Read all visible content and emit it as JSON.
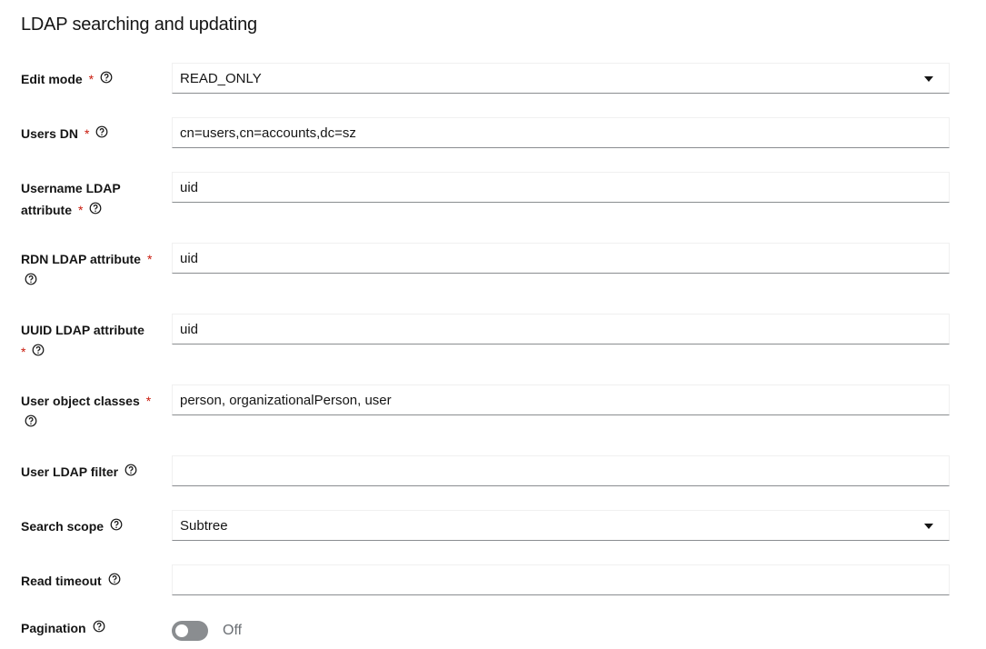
{
  "section": {
    "title": "LDAP searching and updating"
  },
  "fields": {
    "edit_mode": {
      "label": "Edit mode",
      "required_mark": "*",
      "value": "READ_ONLY"
    },
    "users_dn": {
      "label": "Users DN",
      "required_mark": "*",
      "value": "cn=users,cn=accounts,dc=sz"
    },
    "username_attr": {
      "label_line1": "Username LDAP",
      "label_line2": "attribute",
      "required_mark": "*",
      "value": "uid"
    },
    "rdn_attr": {
      "label": "RDN LDAP attribute",
      "required_mark": "*",
      "value": "uid"
    },
    "uuid_attr": {
      "label": "UUID LDAP attribute",
      "required_mark": "*",
      "value": "uid"
    },
    "object_classes": {
      "label": "User object classes",
      "required_mark": "*",
      "value": "person, organizationalPerson, user"
    },
    "ldap_filter": {
      "label": "User LDAP filter",
      "value": ""
    },
    "search_scope": {
      "label": "Search scope",
      "value": "Subtree"
    },
    "read_timeout": {
      "label": "Read timeout",
      "value": ""
    },
    "pagination": {
      "label": "Pagination",
      "state_label": "Off",
      "enabled": false
    }
  },
  "icons": {
    "help": "question-circle-icon",
    "dropdown": "caret-down-icon"
  },
  "colors": {
    "required": "#c9190b",
    "toggle_off": "#8a8d90",
    "field_border": "#8a8d90"
  }
}
